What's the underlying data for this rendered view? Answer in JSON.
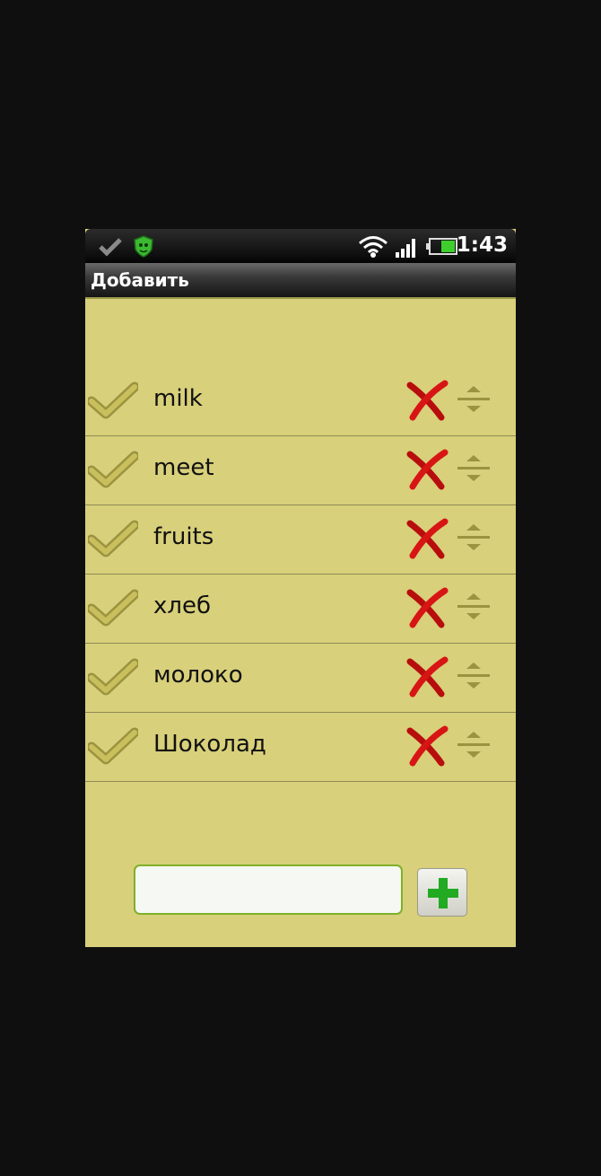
{
  "status_bar": {
    "time": "1:43",
    "icons": [
      "check-notification-icon",
      "antivirus-icon",
      "wifi-icon",
      "signal-icon",
      "battery-icon"
    ]
  },
  "title_bar": {
    "title": "Добавить"
  },
  "list": {
    "items": [
      {
        "label": "milk"
      },
      {
        "label": "meet"
      },
      {
        "label": "fruits"
      },
      {
        "label": "хлеб"
      },
      {
        "label": "молоко"
      },
      {
        "label": "Шоколад"
      }
    ]
  },
  "new_item": {
    "value": "",
    "placeholder": ""
  },
  "colors": {
    "background": "#d8d07a",
    "delete": "#cc1111",
    "add": "#22aa22",
    "input_border": "#7fb02a"
  }
}
